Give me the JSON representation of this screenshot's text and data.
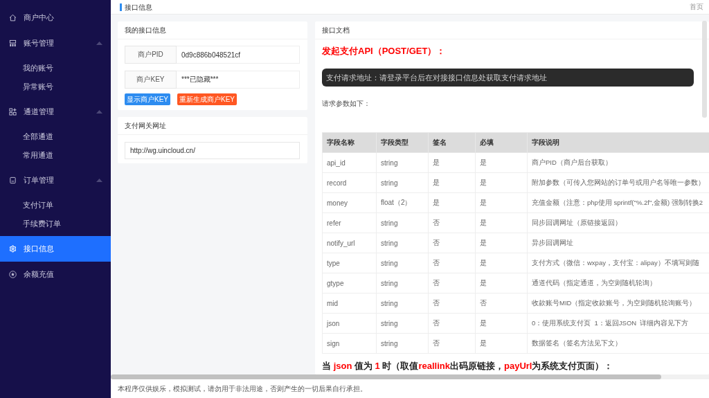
{
  "sidebar": {
    "items": [
      {
        "label": "商户中心",
        "selected": false
      },
      {
        "label": "账号管理",
        "selected": false,
        "expanded": true,
        "children": [
          {
            "label": "我的账号",
            "selected": false
          },
          {
            "label": "异常账号",
            "selected": false
          }
        ]
      },
      {
        "label": "通道管理",
        "selected": false,
        "expanded": true,
        "children": [
          {
            "label": "全部通道",
            "selected": false
          },
          {
            "label": "常用通道",
            "selected": false
          }
        ]
      },
      {
        "label": "订单管理",
        "selected": false,
        "expanded": true,
        "children": [
          {
            "label": "支付订单",
            "selected": false
          },
          {
            "label": "手续费订单",
            "selected": false
          }
        ]
      },
      {
        "label": "接口信息",
        "selected": true
      },
      {
        "label": "余额充值",
        "selected": false
      }
    ]
  },
  "header": {
    "title": "接口信息",
    "home_link": "首页"
  },
  "my_api_info": {
    "title": "我的接口信息",
    "fields": [
      {
        "label": "商户PID",
        "value": "0d9c886b048521cf"
      },
      {
        "label": "商户KEY",
        "value": "***已隐藏***"
      }
    ],
    "buttons": [
      {
        "label": "显示商户KEY",
        "kind": "primary"
      },
      {
        "label": "重新生成商户KEY",
        "kind": "danger"
      }
    ]
  },
  "gateway": {
    "title": "支付网关网址",
    "value": "http://wg.uincloud.cn/"
  },
  "docs": {
    "title": "接口文档",
    "heading": "发起支付API（POST/GET）：",
    "request_url": "支付请求地址：请登录平台后在对接接口信息处获取支付请求地址",
    "params_intro": "请求参数如下：",
    "table": {
      "columns": [
        "字段名称",
        "字段类型",
        "签名",
        "必填",
        "字段说明"
      ],
      "rows": [
        [
          "api_id",
          "string",
          "是",
          "是",
          "商户PID（商户后台获取）"
        ],
        [
          "record",
          "string",
          "是",
          "是",
          "附加参数（可传入您网站的订单号或用户名等唯一参数）"
        ],
        [
          "money",
          "float（2）",
          "是",
          "是",
          "充值金额（注意：php使用 sprintf(\"%.2f\",金额) 强制转换2"
        ],
        [
          "refer",
          "string",
          "否",
          "是",
          "同步回调网址（原链接返回）"
        ],
        [
          "notify_url",
          "string",
          "否",
          "是",
          "异步回调网址"
        ],
        [
          "type",
          "string",
          "否",
          "是",
          "支付方式（微信：wxpay，支付宝：alipay）不填写则随"
        ],
        [
          "gtype",
          "string",
          "否",
          "是",
          "通道代码（指定通道，为空则随机轮询）"
        ],
        [
          "mid",
          "string",
          "否",
          "否",
          "收款账号MID（指定收款账号，为空则随机轮询账号）"
        ],
        [
          "json",
          "string",
          "否",
          "是",
          "0：使用系统支付页  1：返回JSON  详细内容见下方"
        ],
        [
          "sign",
          "string",
          "否",
          "是",
          "数据签名（签名方法见下文）"
        ]
      ]
    },
    "note_heading": [
      {
        "text": "当 ",
        "emphasis": false
      },
      {
        "text": "json",
        "emphasis": true
      },
      {
        "text": " 值为 ",
        "emphasis": false
      },
      {
        "text": "1",
        "emphasis": true
      },
      {
        "text": " 时（取值",
        "emphasis": false
      },
      {
        "text": "reallink",
        "emphasis": true
      },
      {
        "text": "出码原链接，",
        "emphasis": false
      },
      {
        "text": "payUrl",
        "emphasis": true
      },
      {
        "text": "为系统支付页面）：",
        "emphasis": false
      }
    ]
  },
  "footer": {
    "text": "本程序仅供娱乐，模拟测试，请勿用于非法用途，否则产生的一切后果自行承担。"
  }
}
